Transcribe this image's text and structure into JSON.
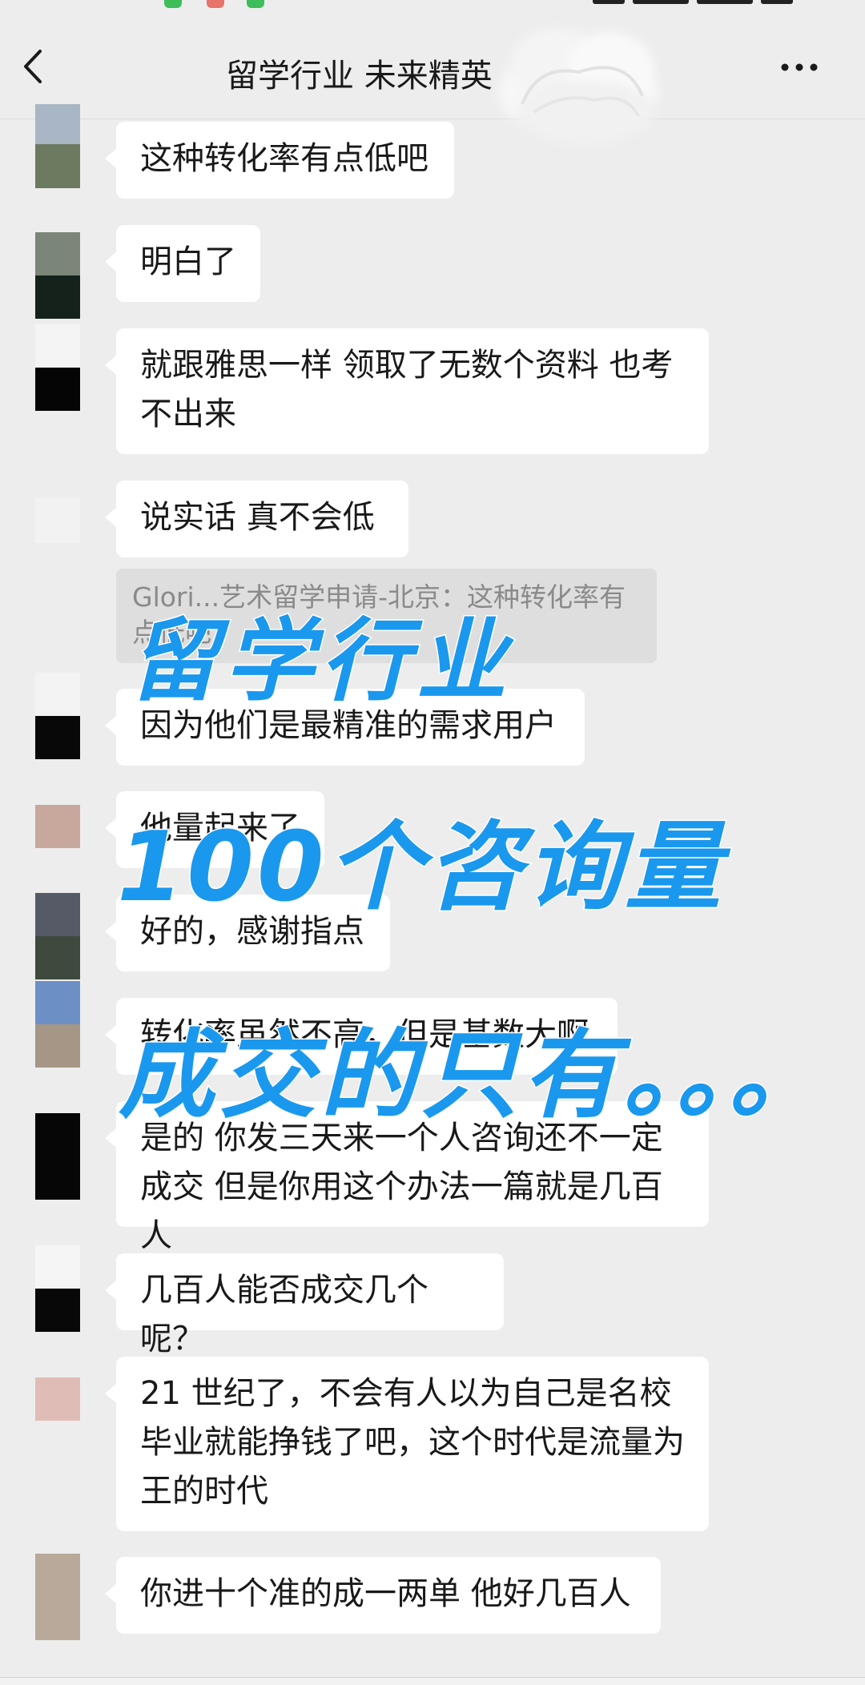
{
  "nav": {
    "title": "留学行业 未来精英",
    "back_icon": "chevron-left-icon",
    "more_icon": "more-dots-icon"
  },
  "messages": [
    {
      "text": "这种转化率有点低吧"
    },
    {
      "text": "明白了"
    },
    {
      "text": "就跟雅思一样 领取了无数个资料 也考不出来"
    },
    {
      "text": "说实话 真不会低"
    },
    {
      "text": "因为他们是最精准的需求用户"
    },
    {
      "text": "他量起来了"
    },
    {
      "text": "好的，感谢指点"
    },
    {
      "text": "转化率虽然不高，但是基数大啊"
    },
    {
      "text": "是的 你发三天来一个人咨询还不一定成交  但是你用这个办法一篇就是几百人"
    },
    {
      "text": "几百人能否成交几个呢？"
    },
    {
      "text": "21 世纪了，不会有人以为自己是名校毕业就能挣钱了吧，这个时代是流量为王的时代"
    },
    {
      "text": "你进十个准的成一两单 他好几百人"
    }
  ],
  "quote": {
    "text": "Glori...艺术留学申请-北京：这种转化率有点低吧"
  },
  "overlay": {
    "line1": "留学行业",
    "line2": "100个咨询量",
    "line3": "成交的只有。。。"
  },
  "colors": {
    "background": "#ededed",
    "bubble": "#ffffff",
    "overlay_text": "#1a98ee",
    "quote_bg": "#dedede"
  }
}
